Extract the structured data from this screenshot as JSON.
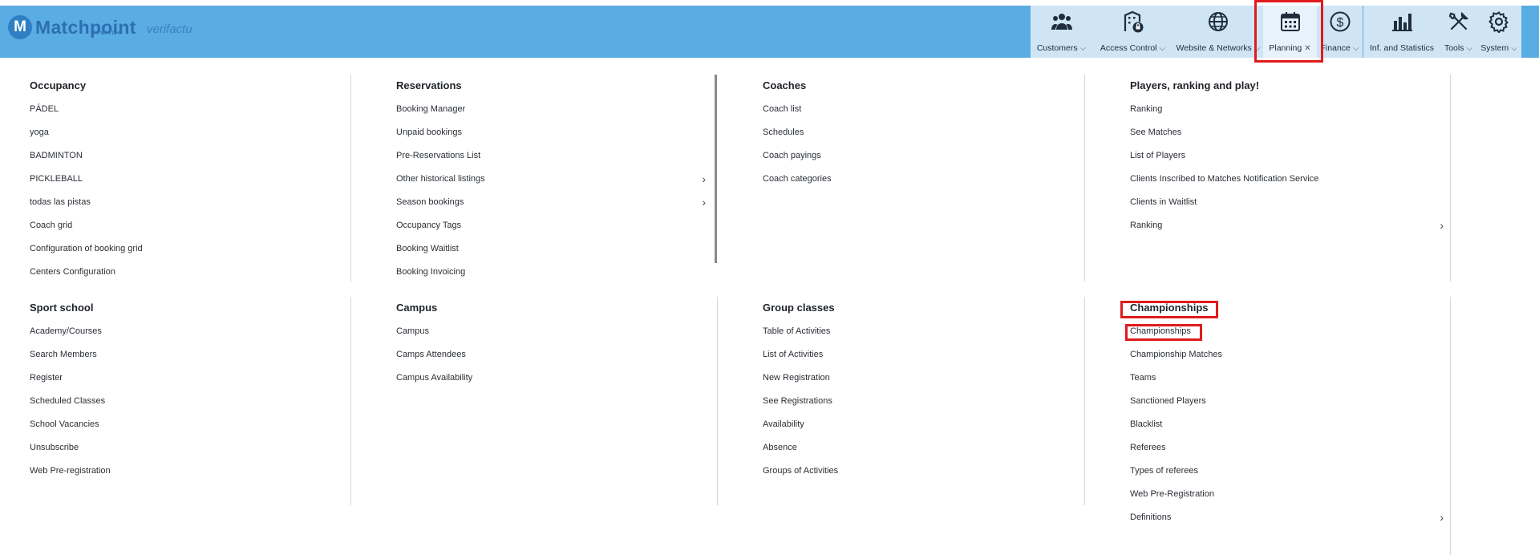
{
  "brand": {
    "name": "Matchpoint",
    "mark": "M",
    "sub": "BY MATCHI",
    "partner": "verifactu"
  },
  "toolbar": [
    {
      "label": "Customers",
      "icon": "users-icon",
      "mark": "chevron"
    },
    {
      "label": "Access Control",
      "icon": "building-lock-icon",
      "mark": "chevron"
    },
    {
      "label": "Website & Networks",
      "icon": "globe-icon",
      "mark": "chevron"
    },
    {
      "label": "Planning",
      "icon": "calendar-icon",
      "mark": "close"
    },
    {
      "label": "Finance",
      "icon": "dollar-icon",
      "mark": "chevron"
    },
    {
      "label": "Inf. and Statistics",
      "icon": "bar-chart-icon",
      "mark": "none"
    },
    {
      "label": "Tools",
      "icon": "tools-icon",
      "mark": "chevron"
    },
    {
      "label": "System",
      "icon": "gear-icon",
      "mark": "chevron"
    }
  ],
  "sections": [
    {
      "title": "Occupancy",
      "items": [
        {
          "label": "PÁDEL"
        },
        {
          "label": "yoga"
        },
        {
          "label": "BADMINTON"
        },
        {
          "label": "PICKLEBALL"
        },
        {
          "label": "todas las pistas"
        },
        {
          "label": "Coach grid"
        },
        {
          "label": "Configuration of booking grid"
        },
        {
          "label": "Centers Configuration"
        }
      ]
    },
    {
      "title": "Reservations",
      "items": [
        {
          "label": "Booking Manager"
        },
        {
          "label": "Unpaid bookings"
        },
        {
          "label": "Pre-Reservations List"
        },
        {
          "label": "Other historical listings",
          "submenu": true
        },
        {
          "label": "Season bookings",
          "submenu": true
        },
        {
          "label": "Occupancy Tags"
        },
        {
          "label": "Booking Waitlist"
        },
        {
          "label": "Booking Invoicing"
        }
      ]
    },
    {
      "title": "Coaches",
      "items": [
        {
          "label": "Coach list"
        },
        {
          "label": "Schedules"
        },
        {
          "label": "Coach payings"
        },
        {
          "label": "Coach categories"
        }
      ]
    },
    {
      "title": "Players, ranking and play!",
      "items": [
        {
          "label": "Ranking"
        },
        {
          "label": "See Matches"
        },
        {
          "label": "List of Players"
        },
        {
          "label": "Clients Inscribed to Matches Notification Service"
        },
        {
          "label": "Clients in Waitlist"
        },
        {
          "label": "Ranking",
          "submenu": true
        }
      ]
    },
    {
      "title": "Sport school",
      "items": [
        {
          "label": "Academy/Courses"
        },
        {
          "label": "Search Members"
        },
        {
          "label": "Register"
        },
        {
          "label": "Scheduled Classes"
        },
        {
          "label": "School Vacancies"
        },
        {
          "label": "Unsubscribe"
        },
        {
          "label": "Web Pre-registration"
        }
      ]
    },
    {
      "title": "Campus",
      "items": [
        {
          "label": "Campus"
        },
        {
          "label": "Camps Attendees"
        },
        {
          "label": "Campus Availability"
        }
      ]
    },
    {
      "title": "Group classes",
      "items": [
        {
          "label": "Table of Activities"
        },
        {
          "label": "List of Activities"
        },
        {
          "label": "New Registration"
        },
        {
          "label": "See Registrations"
        },
        {
          "label": "Availability"
        },
        {
          "label": "Absence"
        },
        {
          "label": "Groups of Activities"
        }
      ]
    },
    {
      "title": "Championships",
      "items": [
        {
          "label": "Championships"
        },
        {
          "label": "Championship Matches"
        },
        {
          "label": "Teams"
        },
        {
          "label": "Sanctioned Players"
        },
        {
          "label": "Blacklist"
        },
        {
          "label": "Referees"
        },
        {
          "label": "Types of referees"
        },
        {
          "label": "Web Pre-Registration"
        },
        {
          "label": "Definitions",
          "submenu": true
        }
      ]
    }
  ],
  "colors": {
    "header": "#5aade2",
    "toolbar": "#cfe5f6",
    "highlight": "#e01b1b"
  }
}
